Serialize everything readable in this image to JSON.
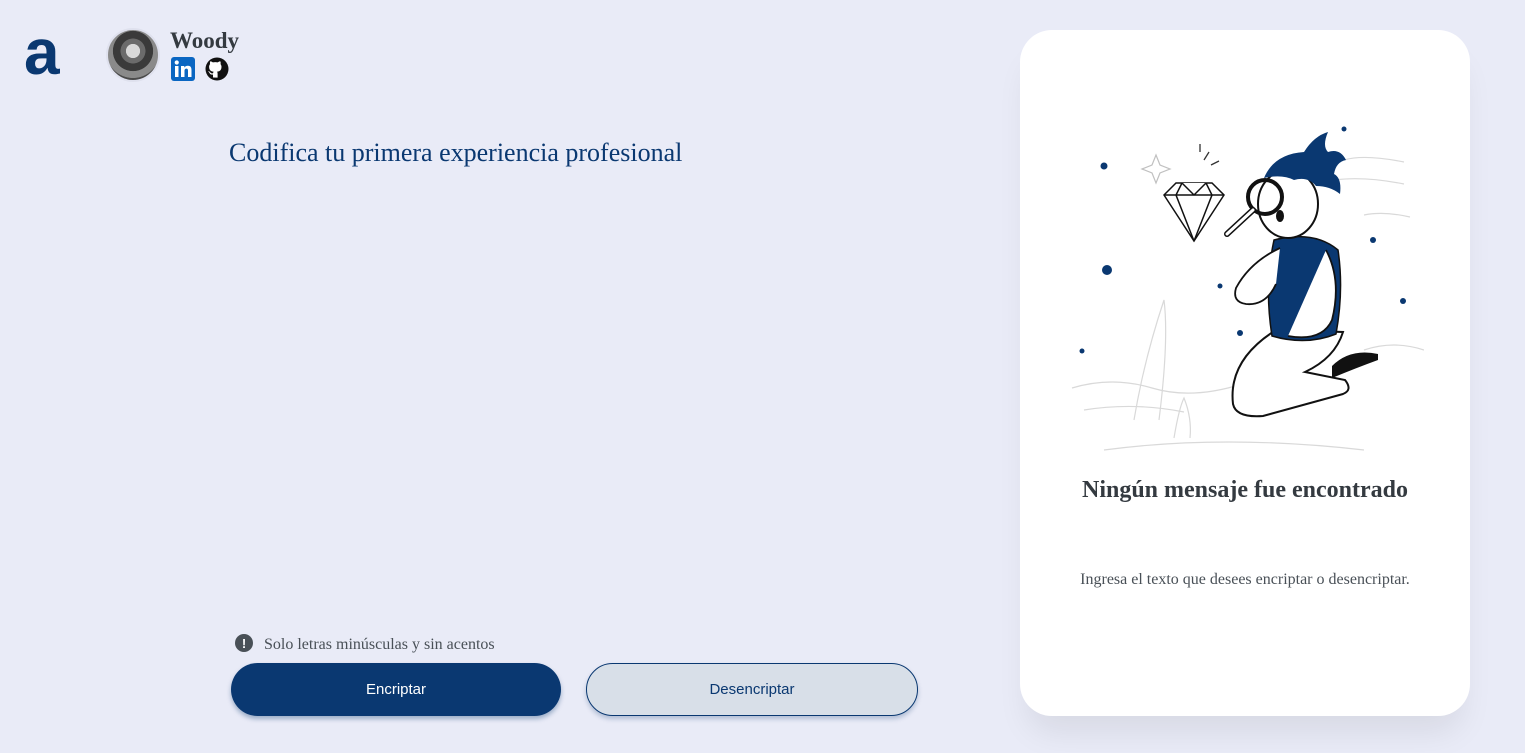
{
  "brand": {
    "logo_text": "a"
  },
  "profile": {
    "name": "Woody",
    "social": [
      {
        "icon": "linkedin-icon",
        "label": "in"
      },
      {
        "icon": "github-icon"
      }
    ]
  },
  "input": {
    "placeholder": "Codifica tu primera experiencia profesional",
    "value": ""
  },
  "hint": {
    "icon": "exclamation-icon",
    "glyph": "!",
    "text": "Solo letras minúsculas y sin acentos"
  },
  "buttons": {
    "encrypt": "Encriptar",
    "decrypt": "Desencriptar"
  },
  "output": {
    "title": "Ningún mensaje fue encontrado",
    "subtitle": "Ingresa el texto que desees encriptar o desencriptar."
  },
  "colors": {
    "background": "#e9ebf7",
    "primary": "#0a3871",
    "panel": "#ffffff",
    "text_dark": "#343a40",
    "text_muted": "#495057",
    "linkedin": "#0a66c2"
  }
}
